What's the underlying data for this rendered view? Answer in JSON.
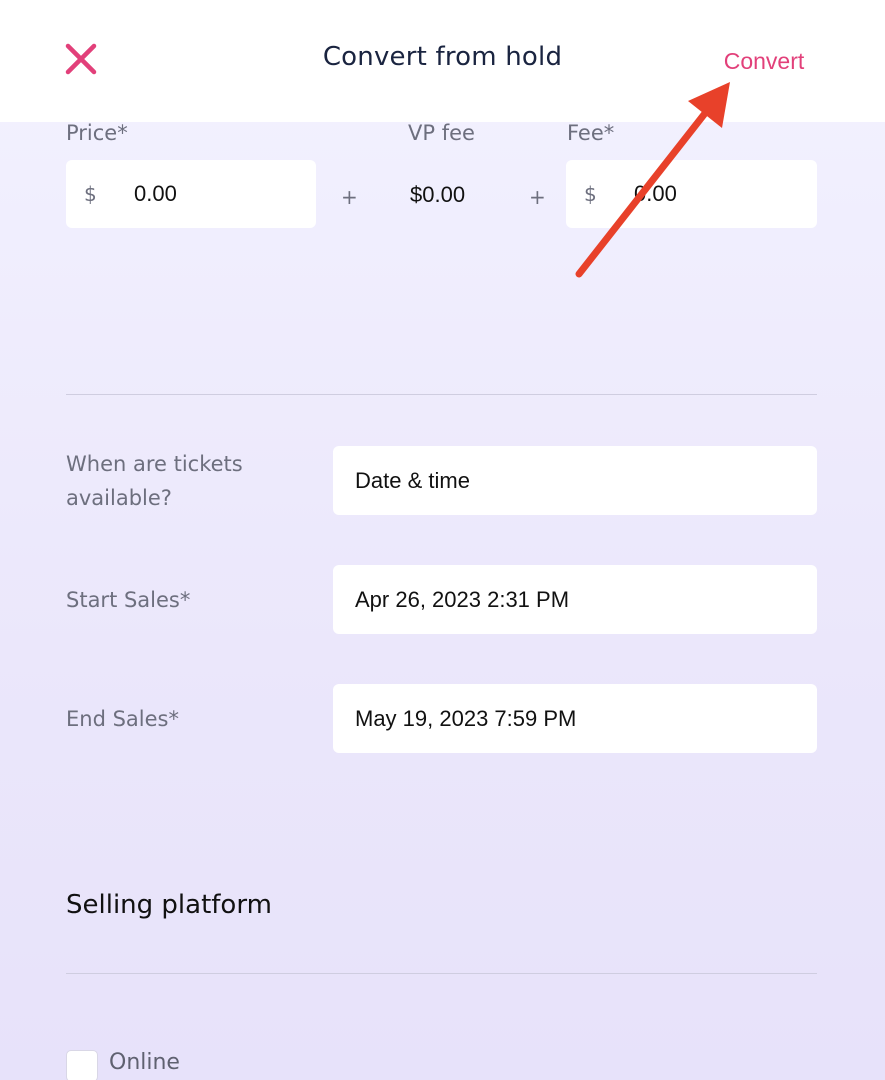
{
  "header": {
    "title": "Convert from hold",
    "convert_label": "Convert"
  },
  "pricing": {
    "price_label": "Price*",
    "price_currency": "$",
    "price_value": "0.00",
    "plus_1": "+",
    "vp_fee_label": "VP fee",
    "vp_fee_value": "$0.00",
    "plus_2": "+",
    "fee_label": "Fee*",
    "fee_currency": "$",
    "fee_value": "0.00"
  },
  "availability": {
    "question_label": "When are tickets available?",
    "question_value": "Date & time",
    "start_label": "Start Sales*",
    "start_value": "Apr 26, 2023 2:31 PM",
    "end_label": "End Sales*",
    "end_value": "May 19, 2023 7:59 PM"
  },
  "selling_platform": {
    "title": "Selling platform",
    "online_label": "Online"
  },
  "colors": {
    "accent": "#e2407a",
    "annotation_arrow": "#e8412a",
    "text_primary": "#1a2440",
    "text_muted": "#6d6f7e"
  },
  "icons": {
    "close": "close-icon",
    "annotation": "arrow-annotation-icon"
  }
}
